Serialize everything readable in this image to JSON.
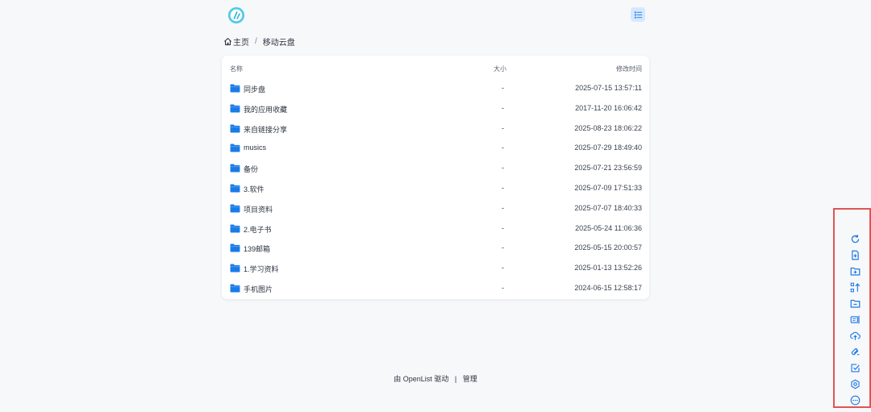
{
  "header": {
    "logo_icon": "openlist-logo",
    "layout_toggle_icon": "list-view-icon"
  },
  "breadcrumb": {
    "home_label": "主页",
    "separator": "/",
    "current": "移动云盘"
  },
  "table": {
    "columns": {
      "name": "名称",
      "size": "大小",
      "modified": "修改时间"
    },
    "rows": [
      {
        "name": "同步盘",
        "size": "-",
        "modified": "2025-07-15 13:57:11"
      },
      {
        "name": "我的应用收藏",
        "size": "-",
        "modified": "2017-11-20 16:06:42"
      },
      {
        "name": "来自链接分享",
        "size": "-",
        "modified": "2025-08-23 18:06:22"
      },
      {
        "name": "musics",
        "size": "-",
        "modified": "2025-07-29 18:49:40"
      },
      {
        "name": "备份",
        "size": "-",
        "modified": "2025-07-21 23:56:59"
      },
      {
        "name": "3.软件",
        "size": "-",
        "modified": "2025-07-09 17:51:33"
      },
      {
        "name": "项目资料",
        "size": "-",
        "modified": "2025-07-07 18:40:33"
      },
      {
        "name": "2.电子书",
        "size": "-",
        "modified": "2025-05-24 11:06:36"
      },
      {
        "name": "139邮箱",
        "size": "-",
        "modified": "2025-05-15 20:00:57"
      },
      {
        "name": "1.学习资料",
        "size": "-",
        "modified": "2025-01-13 13:52:26"
      },
      {
        "name": "手机图片",
        "size": "-",
        "modified": "2024-06-15 12:58:17"
      }
    ]
  },
  "footer": {
    "prefix": "由",
    "link": "OpenList",
    "suffix": "驱动",
    "separator": "|",
    "manage": "管理"
  },
  "sidebar_tools": [
    "refresh-icon",
    "new-file-icon",
    "new-folder-icon",
    "sort-icon",
    "folder-minus-icon",
    "rename-icon",
    "upload-icon",
    "offline-download-icon",
    "select-icon",
    "settings-icon",
    "more-icon"
  ],
  "colors": {
    "accent": "#1e7ae6",
    "folder": "#1a7be8",
    "highlight_border": "#e05456",
    "page_bg": "#f7f8fa"
  }
}
